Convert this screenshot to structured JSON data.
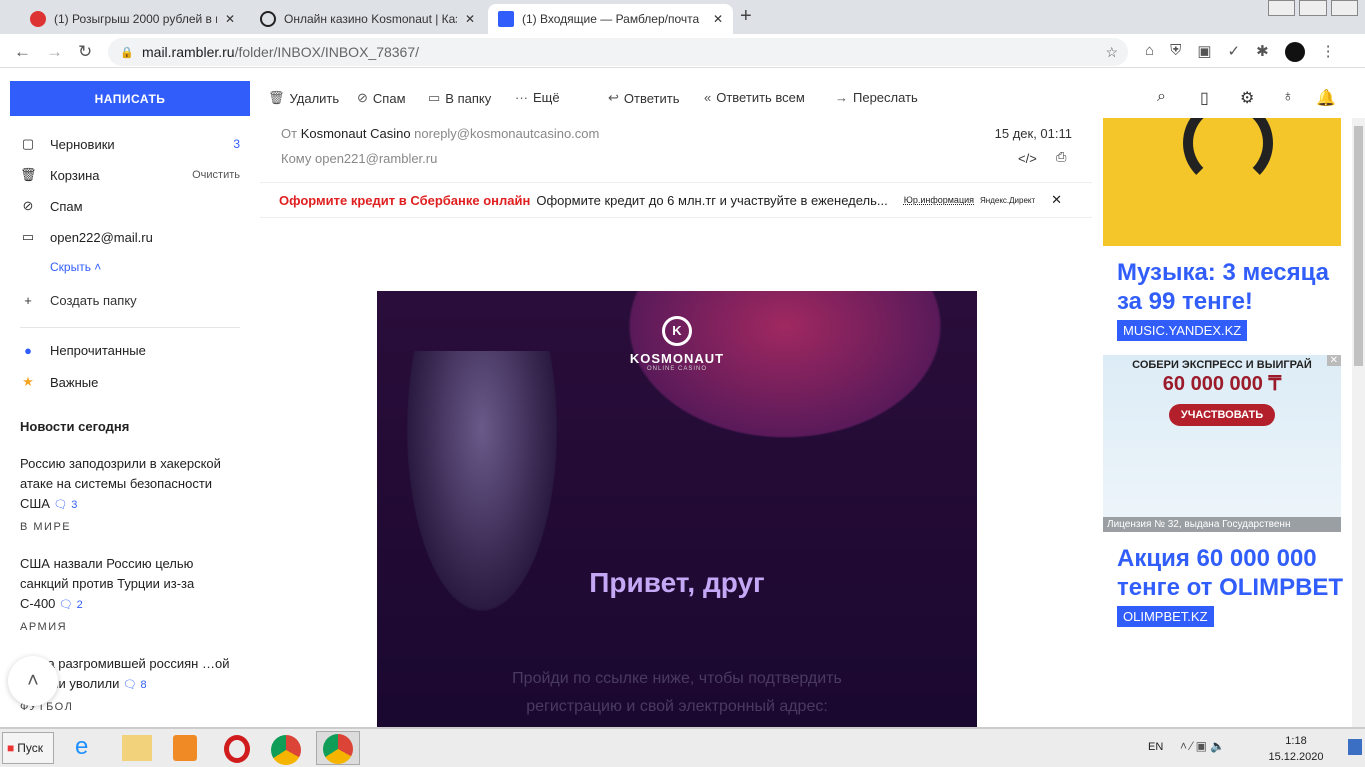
{
  "browser": {
    "tabs": [
      {
        "label": "(1) Розыгрыш 2000 рублей в ново"
      },
      {
        "label": "Онлайн казино Kosmonaut | Казин"
      },
      {
        "label": "(1) Входящие — Рамблер/почта"
      }
    ],
    "url_host": "mail.rambler.ru",
    "url_path": "/folder/INBOX/INBOX_78367/"
  },
  "toolbar": {
    "compose": "НАПИСАТЬ",
    "delete": "Удалить",
    "spam": "Спам",
    "to_folder": "В папку",
    "more": "Ещё",
    "reply": "Ответить",
    "reply_all": "Ответить всем",
    "forward": "Переслать"
  },
  "sidebar": {
    "folders": [
      {
        "label": "Черновики",
        "count": "3"
      },
      {
        "label": "Корзина",
        "action": "Очистить"
      },
      {
        "label": "Спам"
      },
      {
        "label": "open222@mail.ru"
      }
    ],
    "hide": "Скрыть",
    "create_folder": "Создать папку",
    "unread": "Непрочитанные",
    "important": "Важные",
    "news_title": "Новости сегодня",
    "news": [
      {
        "text": "Россию заподозрили в хакерской атаке на системы безопасности США",
        "comments": "3",
        "category": "В МИРЕ"
      },
      {
        "text": "США назвали Россию целью санкций против Турции из-за С-400",
        "comments": "2",
        "category": "АРМИЯ"
      },
      {
        "text": "…ера разгромившей россиян …ой Сербии уволили",
        "comments": "8",
        "category": "ФУТБОЛ"
      }
    ]
  },
  "email": {
    "from_label": "От",
    "from_name": "Kosmonaut Casino",
    "from_email": "noreply@kosmonautcasino.com",
    "date": "15 дек, 01:11",
    "to_label": "Кому",
    "to_email": "open221@rambler.ru",
    "promo": {
      "title": "Оформите кредит в Сбербанке онлайн",
      "text": "Оформите кредит до 6 млн.тг и участвуйте в еженедель...",
      "legal": "Юр.информация",
      "source": "Яндекс.Директ"
    },
    "banner": {
      "brand": "KOSMONAUT",
      "sub": "ONLINE CASINO",
      "greeting": "Привет, друг",
      "body": "Пройди по ссылке ниже, чтобы подтвердить регистрацию и свой электронный адрес:"
    }
  },
  "ads": [
    {
      "title": "Музыка: 3 месяца за 99 тенге!",
      "link": "MUSIC.YANDEX.KZ"
    },
    {
      "banner_top": "СОБЕРИ ЭКСПРЕСС И ВЫИГРАЙ",
      "banner_amount": "60 000 000 ₸",
      "banner_button": "УЧАСТВОВАТЬ",
      "banner_license": "Лицензия № 32, выдана Государственн"
    },
    {
      "title": "Акция 60 000 000 тенге от OLIMPBET",
      "link": "OLIMPBET.KZ"
    }
  ],
  "taskbar": {
    "start": "Пуск",
    "lang": "EN",
    "time": "1:18",
    "date": "15.12.2020"
  }
}
